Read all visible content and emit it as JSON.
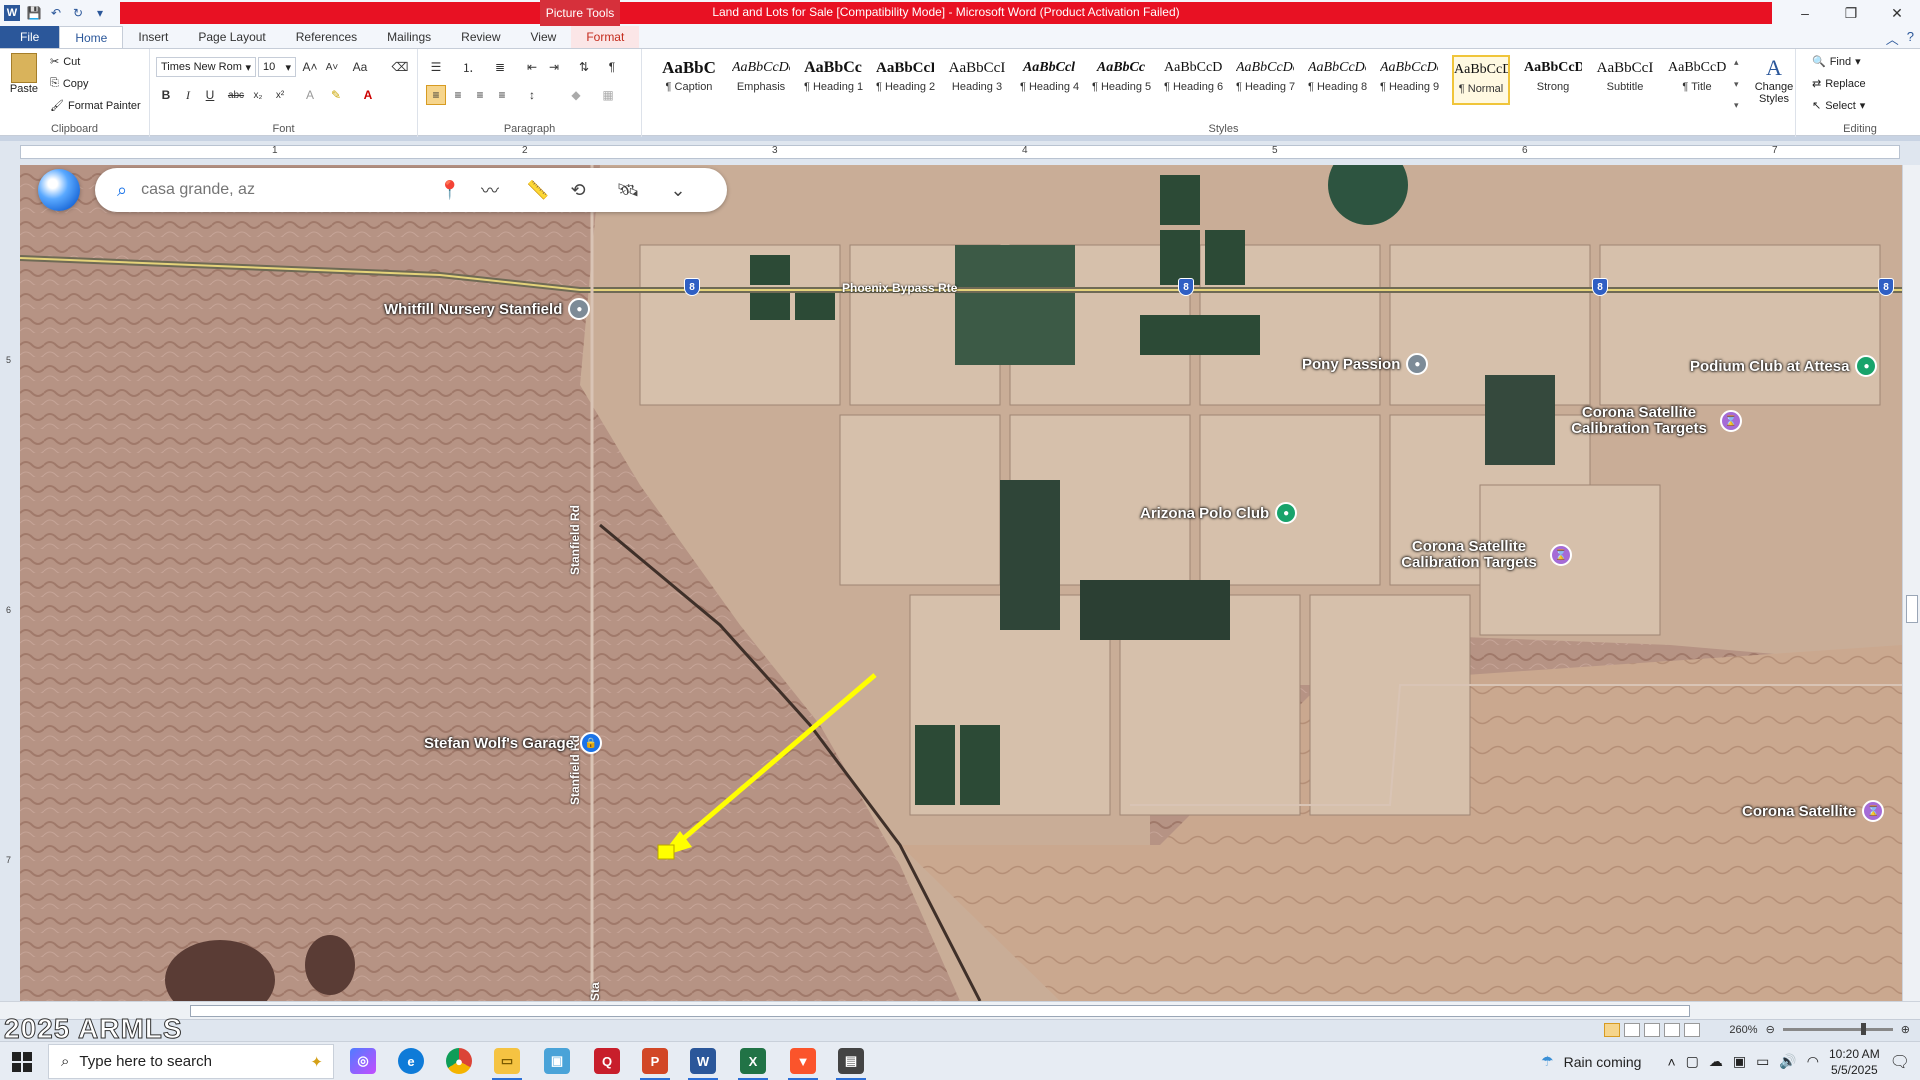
{
  "window": {
    "title": "Land and Lots for Sale [Compatibility Mode] - Microsoft Word (Product Activation Failed)",
    "context_tab_group": "Picture Tools",
    "controls": [
      "–",
      "❐",
      "✕"
    ]
  },
  "tabs": [
    {
      "label": "File"
    },
    {
      "label": "Home"
    },
    {
      "label": "Insert"
    },
    {
      "label": "Page Layout"
    },
    {
      "label": "References"
    },
    {
      "label": "Mailings"
    },
    {
      "label": "Review"
    },
    {
      "label": "View"
    },
    {
      "label": "Format"
    }
  ],
  "ribbon": {
    "clipboard": {
      "label": "Clipboard",
      "paste": "Paste",
      "cut": "Cut",
      "copy": "Copy",
      "format_painter": "Format Painter"
    },
    "font": {
      "label": "Font",
      "family": "Times New Rom",
      "size": "10"
    },
    "paragraph": {
      "label": "Paragraph"
    },
    "styles": {
      "label": "Styles",
      "items": [
        {
          "preview": "AaBbC",
          "name": "¶ Caption"
        },
        {
          "preview": "AaBbCcDc",
          "name": "Emphasis"
        },
        {
          "preview": "AaBbCc",
          "name": "¶ Heading 1"
        },
        {
          "preview": "AaBbCcI",
          "name": "¶ Heading 2"
        },
        {
          "preview": "AaBbCcI",
          "name": "Heading 3"
        },
        {
          "preview": "AaBbCcl",
          "name": "¶ Heading 4"
        },
        {
          "preview": "AaBbCc",
          "name": "¶ Heading 5"
        },
        {
          "preview": "AaBbCcDc",
          "name": "¶ Heading 6"
        },
        {
          "preview": "AaBbCcDc",
          "name": "¶ Heading 7"
        },
        {
          "preview": "AaBbCcDc",
          "name": "¶ Heading 8"
        },
        {
          "preview": "AaBbCcDc",
          "name": "¶ Heading 9"
        },
        {
          "preview": "AaBbCcDc",
          "name": "¶ Normal"
        },
        {
          "preview": "AaBbCcDd",
          "name": "Strong"
        },
        {
          "preview": "AaBbCcI",
          "name": "Subtitle"
        },
        {
          "preview": "AaBbCcDdI",
          "name": "¶ Title"
        }
      ],
      "selected_index": 11,
      "change_styles": "Change Styles"
    },
    "editing": {
      "label": "Editing",
      "find": "Find",
      "replace": "Replace",
      "select": "Select"
    }
  },
  "ruler": {
    "marks": [
      "1",
      "2",
      "3",
      "4",
      "5",
      "6",
      "7"
    ],
    "vmarks": [
      "5",
      "6",
      "7"
    ]
  },
  "map": {
    "search_placeholder": "casa grande, az",
    "road_labels": [
      {
        "text": "Phoenix Bypass Rte"
      },
      {
        "text": "Stanfield Rd"
      },
      {
        "text": "Stanfield Rd"
      },
      {
        "text": "Sta"
      }
    ],
    "shield_label": "8",
    "places": [
      {
        "name": "Whitfill Nursery Stanfield",
        "pin": "gray"
      },
      {
        "name": "Pony Passion",
        "pin": "gray"
      },
      {
        "name": "Podium Club at Attesa",
        "pin": "green"
      },
      {
        "name": "Corona Satellite Calibration Targets",
        "pin": "purple"
      },
      {
        "name": "Arizona Polo Club",
        "pin": "green"
      },
      {
        "name": "Corona Satellite Calibration Targets",
        "pin": "purple"
      },
      {
        "name": "Stefan Wolf's Garage",
        "pin": "blue"
      },
      {
        "name": "Corona Satellite",
        "pin": "purple"
      }
    ]
  },
  "statusbar": {
    "watermark": "2025 ARMLS",
    "zoom": "260%"
  },
  "taskbar": {
    "search_placeholder": "Type here to search",
    "weather": "Rain coming",
    "time": "10:20 AM",
    "date": "5/5/2025"
  },
  "colors": {
    "word_blue": "#2b579a",
    "title_red": "#e81123",
    "arrow_yellow": "#ffff00"
  }
}
